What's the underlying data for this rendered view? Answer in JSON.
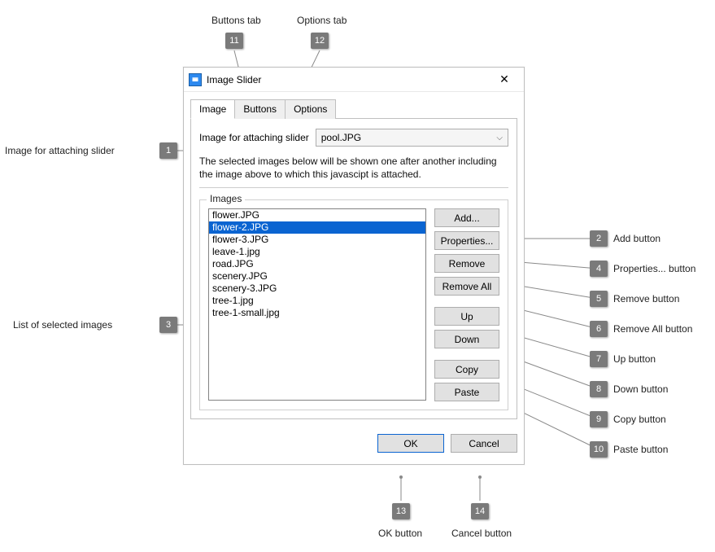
{
  "dialog": {
    "title": "Image Slider",
    "appicon_text": "",
    "tabs": {
      "image": "Image",
      "buttons": "Buttons",
      "options": "Options"
    },
    "attach_label": "Image for attaching slider",
    "attach_value": "pool.JPG",
    "explain": "The selected images below will be shown one after another including the image above to which this javascipt is attached.",
    "images_legend": "Images",
    "images": [
      "flower.JPG",
      "flower-2.JPG",
      "flower-3.JPG",
      "leave-1.jpg",
      "road.JPG",
      "scenery.JPG",
      "scenery-3.JPG",
      "tree-1.jpg",
      "tree-1-small.jpg"
    ],
    "images_selected_index": 1,
    "buttons": {
      "add": "Add...",
      "properties": "Properties...",
      "remove": "Remove",
      "remove_all": "Remove All",
      "up": "Up",
      "down": "Down",
      "copy": "Copy",
      "paste": "Paste"
    },
    "ok": "OK",
    "cancel": "Cancel"
  },
  "callouts": {
    "c1": "Image for attaching slider",
    "c2": "Add button",
    "c3": "List of selected images",
    "c4": "Properties... button",
    "c5": "Remove button",
    "c6": "Remove All button",
    "c7": "Up button",
    "c8": "Down button",
    "c9": "Copy button",
    "c10": "Paste button",
    "c11": "Buttons tab",
    "c12": "Options tab",
    "c13": "OK button",
    "c14": "Cancel button",
    "n1": "1",
    "n2": "2",
    "n3": "3",
    "n4": "4",
    "n5": "5",
    "n6": "6",
    "n7": "7",
    "n8": "8",
    "n9": "9",
    "n10": "10",
    "n11": "11",
    "n12": "12",
    "n13": "13",
    "n14": "14"
  }
}
